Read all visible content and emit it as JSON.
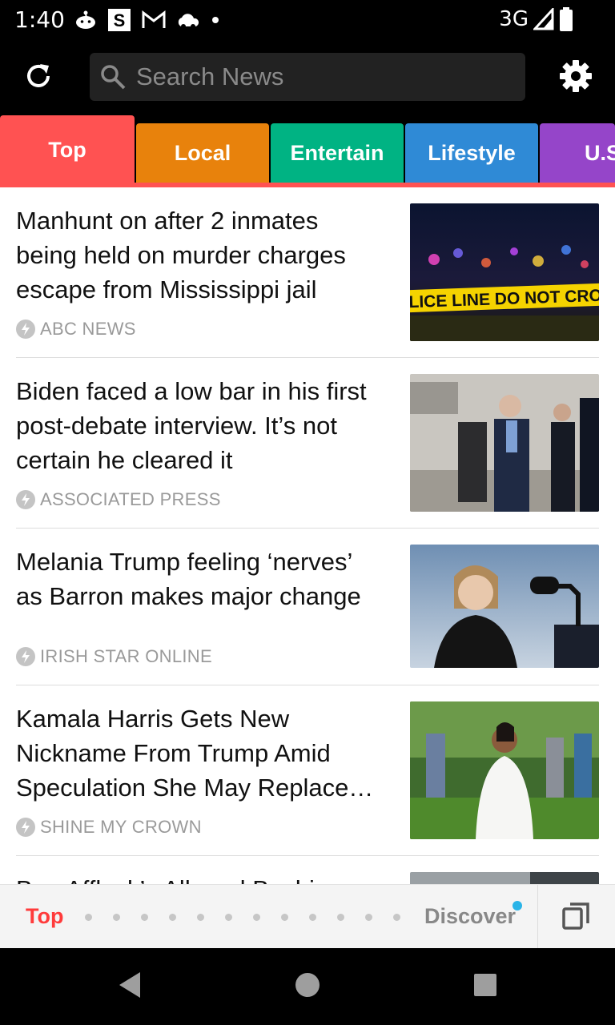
{
  "status_bar": {
    "time": "1:40",
    "network": "3G",
    "icons": [
      "reddit-icon",
      "s-app-icon",
      "gmail-icon",
      "cloud-icon",
      "dot-icon",
      "signal-icon",
      "battery-icon"
    ]
  },
  "search": {
    "placeholder": "Search News"
  },
  "toolbar": {
    "icons": [
      "refresh-icon",
      "search-icon",
      "settings-gear-icon"
    ]
  },
  "tabs": [
    {
      "label": "Top",
      "color": "#ff5252",
      "active": true
    },
    {
      "label": "Local",
      "color": "#e8820c",
      "active": false
    },
    {
      "label": "Entertain",
      "color": "#00b383",
      "active": false
    },
    {
      "label": "Lifestyle",
      "color": "#2f8ad6",
      "active": false
    },
    {
      "label": "U.S",
      "color": "#9545c9",
      "active": false
    }
  ],
  "articles": [
    {
      "headline": "Manhunt on after 2 inmates being held on murder charges escape from Mississippi jail",
      "source": "ABC NEWS",
      "thumb_text": "POLICE LINE DO NOT CROSS"
    },
    {
      "headline": "Biden faced a low bar in his first post-debate interview. It’s not certain he cleared it",
      "source": "ASSOCIATED PRESS"
    },
    {
      "headline": "Melania Trump feeling ‘nerves’ as Barron makes major change",
      "source": "IRISH STAR ONLINE"
    },
    {
      "headline": "Kamala Harris Gets New Nickname From Trump Amid Speculation She May Replace…",
      "source": "SHINE MY CROWN"
    },
    {
      "headline": "Ben Affleck’s Alleged Bachi…",
      "source": ""
    }
  ],
  "bottom_nav": {
    "top_label": "Top",
    "discover_label": "Discover",
    "page_dots": 12,
    "accent": "#ff3b3b",
    "badge_color": "#2ab4e8"
  }
}
